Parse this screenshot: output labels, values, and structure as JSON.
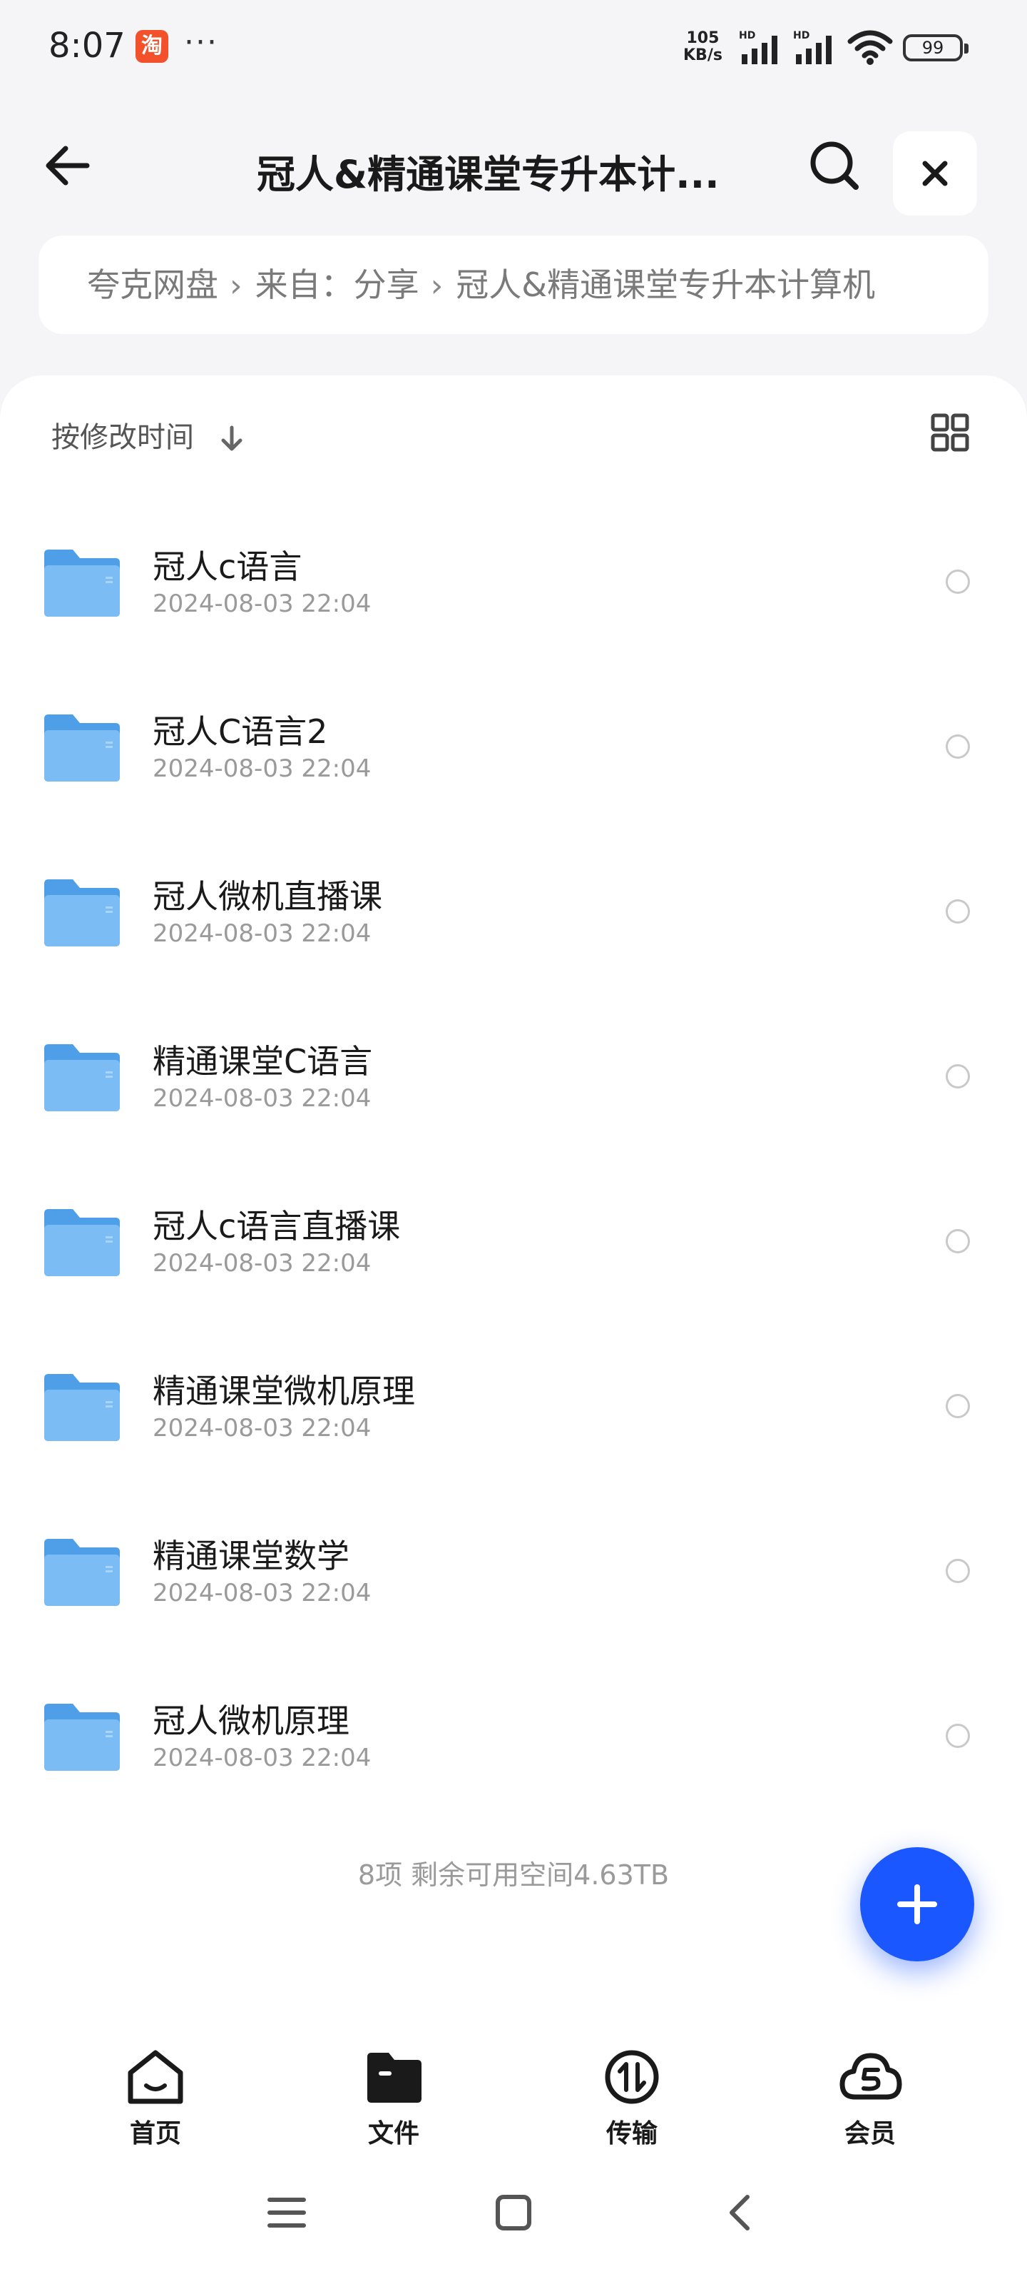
{
  "status": {
    "time": "8:07",
    "app_badge": "淘",
    "more": "···",
    "net_speed_value": "105",
    "net_speed_unit": "KB/s",
    "battery": "99"
  },
  "header": {
    "title": "冠人&精通课堂专升本计..."
  },
  "breadcrumb": {
    "items": [
      "夸克网盘",
      "来自：分享",
      "冠人&精通课堂专升本计算机"
    ]
  },
  "sort": {
    "label": "按修改时间"
  },
  "files": [
    {
      "name": "冠人c语言",
      "date": "2024-08-03 22:04"
    },
    {
      "name": "冠人C语言2",
      "date": "2024-08-03 22:04"
    },
    {
      "name": "冠人微机直播课",
      "date": "2024-08-03 22:04"
    },
    {
      "name": "精通课堂C语言",
      "date": "2024-08-03 22:04"
    },
    {
      "name": "冠人c语言直播课",
      "date": "2024-08-03 22:04"
    },
    {
      "name": "精通课堂微机原理",
      "date": "2024-08-03 22:04"
    },
    {
      "name": "精通课堂数学",
      "date": "2024-08-03 22:04"
    },
    {
      "name": "冠人微机原理",
      "date": "2024-08-03 22:04"
    }
  ],
  "summary": "8项  剩余可用空间4.63TB",
  "nav": {
    "home": "首页",
    "files": "文件",
    "transfer": "传输",
    "member": "会员"
  },
  "colors": {
    "accent": "#1a57ff",
    "folder": "#5aa9f0"
  },
  "icons": [
    "back-arrow-icon",
    "search-icon",
    "close-icon",
    "sort-down-icon",
    "grid-view-icon",
    "folder-icon",
    "plus-icon",
    "home-icon",
    "folder-nav-icon",
    "transfer-icon",
    "member-cloud-icon",
    "menu-icon",
    "square-icon",
    "back-chevron-icon"
  ]
}
